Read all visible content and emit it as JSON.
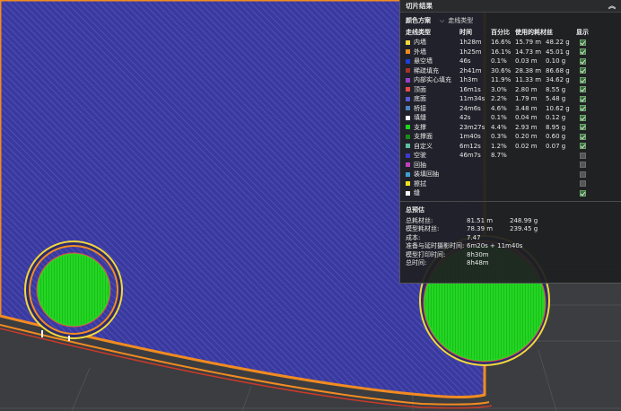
{
  "panel": {
    "title": "切片结果",
    "collapse_icon": "double-chevron-up-icon",
    "scheme_label": "颜色方案",
    "scheme_value": "走线类型",
    "headers": {
      "type": "走线类型",
      "time": "时间",
      "percent": "百分比",
      "filament": "使用的耗材丝",
      "show": "显示"
    },
    "rows": [
      {
        "name": "内墙",
        "color": "#f3d83a",
        "time": "1h28m",
        "percent": "16.6%",
        "length": "15.79 m",
        "weight": "48.22 g",
        "shown": true
      },
      {
        "name": "外墙",
        "color": "#f28b20",
        "time": "1h25m",
        "percent": "16.1%",
        "length": "14.73 m",
        "weight": "45.01 g",
        "shown": true
      },
      {
        "name": "悬空墙",
        "color": "#1f3fd6",
        "time": "46s",
        "percent": "0.1%",
        "length": "0.03 m",
        "weight": "0.10 g",
        "shown": true
      },
      {
        "name": "稀疏填充",
        "color": "#a8322e",
        "time": "2h41m",
        "percent": "30.6%",
        "length": "28.38 m",
        "weight": "86.68 g",
        "shown": true
      },
      {
        "name": "内部实心填充",
        "color": "#9a3fc9",
        "time": "1h3m",
        "percent": "11.9%",
        "length": "11.33 m",
        "weight": "34.62 g",
        "shown": true
      },
      {
        "name": "顶面",
        "color": "#e84a4a",
        "time": "16m1s",
        "percent": "3.0%",
        "length": "2.80 m",
        "weight": "8.55 g",
        "shown": true
      },
      {
        "name": "底面",
        "color": "#5a5ad6",
        "time": "11m34s",
        "percent": "2.2%",
        "length": "1.79 m",
        "weight": "5.48 g",
        "shown": true
      },
      {
        "name": "桥接",
        "color": "#4f86c6",
        "time": "24m6s",
        "percent": "4.6%",
        "length": "3.48 m",
        "weight": "10.62 g",
        "shown": true
      },
      {
        "name": "填缝",
        "color": "#ffffff",
        "time": "42s",
        "percent": "0.1%",
        "length": "0.04 m",
        "weight": "0.12 g",
        "shown": true
      },
      {
        "name": "支撑",
        "color": "#1fd61f",
        "time": "23m27s",
        "percent": "4.4%",
        "length": "2.93 m",
        "weight": "8.95 g",
        "shown": true
      },
      {
        "name": "支撑面",
        "color": "#1a8a1a",
        "time": "1m40s",
        "percent": "0.3%",
        "length": "0.20 m",
        "weight": "0.60 g",
        "shown": true
      },
      {
        "name": "自定义",
        "color": "#5fbfa0",
        "time": "6m12s",
        "percent": "1.2%",
        "length": "0.02 m",
        "weight": "0.07 g",
        "shown": true
      },
      {
        "name": "空驶",
        "color": "#3a3ad0",
        "time": "46m7s",
        "percent": "8.7%",
        "length": "",
        "weight": "",
        "shown": false
      },
      {
        "name": "回抽",
        "color": "#c040c0",
        "time": "",
        "percent": "",
        "length": "",
        "weight": "",
        "shown": false
      },
      {
        "name": "装填回抽",
        "color": "#3fa0d0",
        "time": "",
        "percent": "",
        "length": "",
        "weight": "",
        "shown": false
      },
      {
        "name": "擦拭",
        "color": "#f0e020",
        "time": "",
        "percent": "",
        "length": "",
        "weight": "",
        "shown": false
      },
      {
        "name": "缝",
        "color": "#f4f4f4",
        "time": "",
        "percent": "",
        "length": "",
        "weight": "",
        "shown": true
      }
    ],
    "estimate_title": "总预估",
    "estimates": [
      {
        "label": "总耗材丝:",
        "a": "81.51 m",
        "b": "248.99 g"
      },
      {
        "label": "模型耗材丝:",
        "a": "78.39 m",
        "b": "239.45 g"
      },
      {
        "label": "成本:",
        "a": "7.47",
        "b": ""
      },
      {
        "label": "准备与延时摄影时间:",
        "a": "6m20s + 11m40s",
        "b": ""
      },
      {
        "label": "模型打印时间:",
        "a": "8h30m",
        "b": ""
      },
      {
        "label": "总时间:",
        "a": "8h48m",
        "b": ""
      }
    ]
  },
  "colors": {
    "background": "#3b3d40",
    "model_fill": "#3a3a9e",
    "support": "#23d623",
    "outer_wall": "#f28b20",
    "inner_wall": "#f3d83a"
  }
}
